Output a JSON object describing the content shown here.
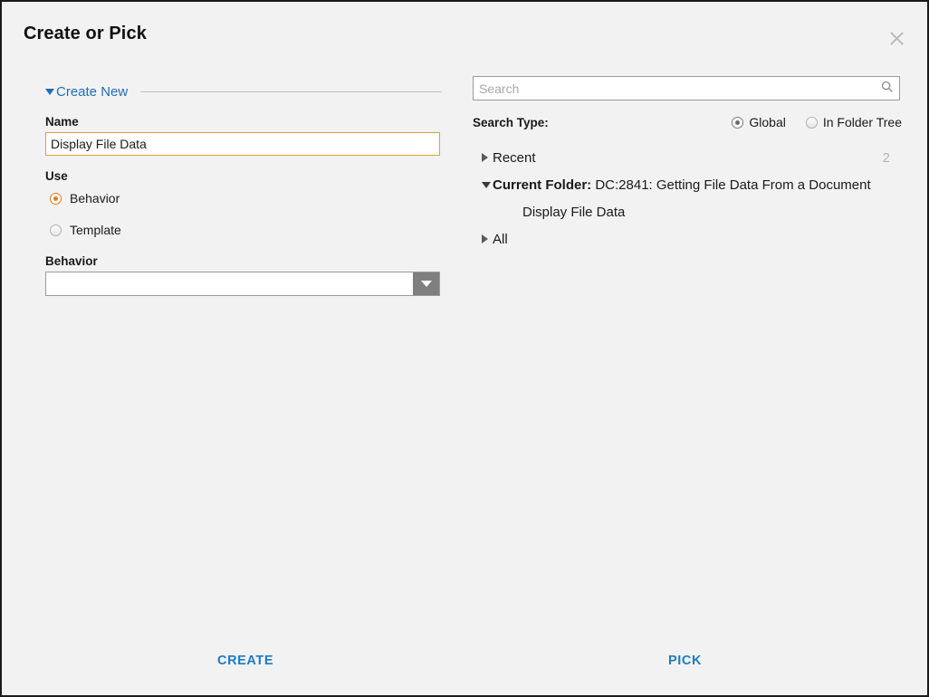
{
  "dialog": {
    "title": "Create or Pick",
    "close_icon": "close-icon"
  },
  "left_panel": {
    "section": {
      "label": "Create New",
      "expanded": true,
      "caret_icon": "caret-down-icon",
      "accent_color": "#1d6fb8"
    },
    "name": {
      "label": "Name",
      "value": "Display File Data",
      "placeholder": "",
      "focused": true,
      "border_color": "#e0a13c"
    },
    "use": {
      "label": "Use",
      "options": [
        {
          "label": "Behavior",
          "selected": true
        },
        {
          "label": "Template",
          "selected": false
        }
      ],
      "selected_color": "#e07b18"
    },
    "behavior": {
      "label": "Behavior",
      "value": "",
      "arrow_icon": "chevron-down-icon",
      "arrow_bg": "#7f7f7f"
    }
  },
  "right_panel": {
    "search": {
      "placeholder": "Search",
      "value": "",
      "icon": "search-icon"
    },
    "search_type": {
      "label": "Search Type:",
      "options": [
        {
          "label": "Global",
          "selected": true
        },
        {
          "label": "In Folder Tree",
          "selected": false
        }
      ]
    },
    "tree": [
      {
        "label": "Recent",
        "bold_prefix": "",
        "expanded": false,
        "caret_icon": "caret-right-icon",
        "count": "2",
        "indent": 0
      },
      {
        "label": "DC:2841: Getting File Data From a Document",
        "bold_prefix": "Current Folder:",
        "expanded": true,
        "caret_icon": "caret-down-icon",
        "count": "",
        "indent": 0
      },
      {
        "label": "Display File Data",
        "bold_prefix": "",
        "expanded": null,
        "caret_icon": "",
        "count": "",
        "indent": 1
      },
      {
        "label": "All",
        "bold_prefix": "",
        "expanded": false,
        "caret_icon": "caret-right-icon",
        "count": "",
        "indent": 0
      }
    ]
  },
  "footer": {
    "create_label": "CREATE",
    "pick_label": "PICK",
    "link_color": "#1d7bc4"
  }
}
